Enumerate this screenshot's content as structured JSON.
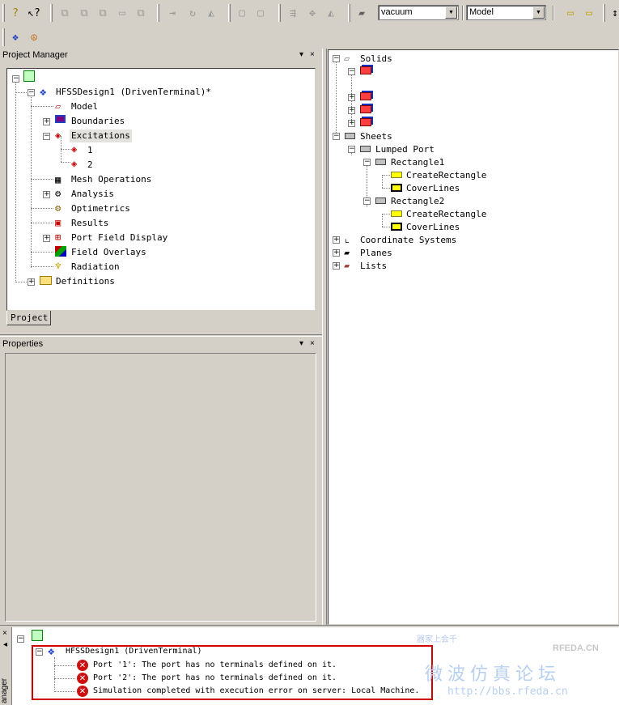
{
  "toolbar": {
    "material_select": "vacuum",
    "model_select": "Model"
  },
  "project_manager": {
    "title": "Project Manager",
    "close": "×",
    "tab": "Project",
    "tree": {
      "design": "HFSSDesign1 (DrivenTerminal)*",
      "items": {
        "model": "Model",
        "boundaries": "Boundaries",
        "excitations": "Excitations",
        "port1": "1",
        "port2": "2",
        "mesh": "Mesh Operations",
        "analysis": "Analysis",
        "optimetrics": "Optimetrics",
        "results": "Results",
        "port_field": "Port Field Display",
        "field_overlays": "Field Overlays",
        "radiation": "Radiation",
        "definitions": "Definitions"
      }
    }
  },
  "properties": {
    "title": "Properties",
    "close": "×"
  },
  "model_tree": {
    "solids": "Solids",
    "sheets": "Sheets",
    "lumped_port": "Lumped Port",
    "rect1": "Rectangle1",
    "rect1_create": "CreateRectangle",
    "rect1_cover": "CoverLines",
    "rect2": "Rectangle2",
    "rect2_create": "CreateRectangle",
    "rect2_cover": "CoverLines",
    "coord": "Coordinate Systems",
    "planes": "Planes",
    "lists": "Lists"
  },
  "messages": {
    "side_label": "anager",
    "design": "HFSSDesign1 (DrivenTerminal)",
    "lines": [
      "Port '1': The port has no terminals defined on it.",
      "Port '2': The port has no terminals defined on it.",
      "Simulation completed with execution error on server: Local Machine."
    ],
    "highlight_color": "#d00000"
  },
  "watermark": {
    "brand": "RFEDA.CN",
    "cn": "微波仿真论坛",
    "url": "http://bbs.rfeda.cn",
    "top": "器家上会千"
  }
}
